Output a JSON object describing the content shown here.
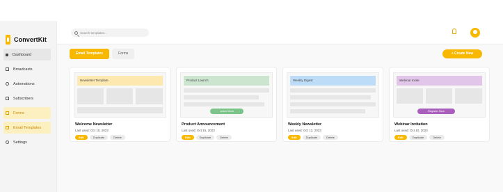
{
  "brand": {
    "name": "ConvertKit"
  },
  "sidebar": {
    "items": [
      {
        "label": "Dashboard",
        "icon": "dashboard-icon"
      },
      {
        "label": "Broadcasts",
        "icon": "broadcast-icon"
      },
      {
        "label": "Automations",
        "icon": "automation-icon"
      },
      {
        "label": "Subscribers",
        "icon": "subscribers-icon"
      },
      {
        "label": "Forms",
        "icon": "forms-icon"
      },
      {
        "label": "Email Templates",
        "icon": "email-templates-icon"
      },
      {
        "label": "Settings",
        "icon": "settings-icon"
      }
    ]
  },
  "header": {
    "search_placeholder": "Search templates..."
  },
  "tabs": [
    {
      "label": "Email Templates"
    },
    {
      "label": "Forms"
    }
  ],
  "create_button": "+ Create New",
  "colors": {
    "accent": "#f9b800"
  },
  "templates": [
    {
      "preview_label": "Newsletter Template",
      "preview_color": "#fde8b0",
      "name": "Welcome Newsletter",
      "date": "Last used: Oct 10, 2023",
      "cta": ""
    },
    {
      "preview_label": "Product Launch",
      "preview_color": "#cce5cf",
      "name": "Product Announcement",
      "date": "Last used: Oct 15, 2023",
      "cta": "Learn More",
      "cta_color": "#7dc48a"
    },
    {
      "preview_label": "Weekly Digest",
      "preview_color": "#bddcf7",
      "name": "Weekly Newsletter",
      "date": "Last used: Oct 12, 2023",
      "cta": ""
    },
    {
      "preview_label": "Webinar Invite",
      "preview_color": "#e2c6e9",
      "name": "Webinar Invitation",
      "date": "Last used: Oct 10, 2023",
      "cta": "Register Now",
      "cta_color": "#a960bd"
    }
  ],
  "card_actions": {
    "edit": "Edit",
    "duplicate": "Duplicate",
    "delete": "Delete"
  }
}
